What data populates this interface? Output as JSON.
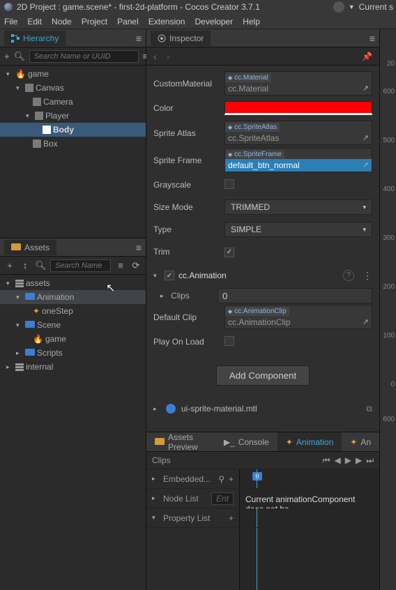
{
  "titlebar": "2D Project : game.scene* - first-2d-platform - Cocos Creator 3.7.1",
  "toolbar": {
    "current": "Current s"
  },
  "menu": [
    "File",
    "Edit",
    "Node",
    "Project",
    "Panel",
    "Extension",
    "Developer",
    "Help"
  ],
  "hierarchy": {
    "title": "Hierarchy",
    "search_placeholder": "Search Name or UUID",
    "items": [
      {
        "label": "game",
        "depth": 0,
        "icon": "fire",
        "expanded": true
      },
      {
        "label": "Canvas",
        "depth": 1,
        "icon": "cube",
        "expanded": true
      },
      {
        "label": "Camera",
        "depth": 2,
        "icon": "cube"
      },
      {
        "label": "Player",
        "depth": 2,
        "icon": "cube",
        "expanded": true
      },
      {
        "label": "Body",
        "depth": 3,
        "icon": "cube",
        "selected": true
      },
      {
        "label": "Box",
        "depth": 2,
        "icon": "cube"
      }
    ]
  },
  "assets": {
    "title": "Assets",
    "search_placeholder": "Search Name",
    "items": [
      {
        "label": "assets",
        "depth": 0,
        "icon": "db",
        "expanded": true
      },
      {
        "label": "Animation",
        "depth": 1,
        "icon": "folder-blue",
        "expanded": true,
        "selected": true
      },
      {
        "label": "oneStep",
        "depth": 2,
        "icon": "anim"
      },
      {
        "label": "Scene",
        "depth": 1,
        "icon": "folder-blue",
        "expanded": true
      },
      {
        "label": "game",
        "depth": 2,
        "icon": "fire"
      },
      {
        "label": "Scripts",
        "depth": 1,
        "icon": "folder-blue"
      },
      {
        "label": "internal",
        "depth": 0,
        "icon": "db"
      }
    ]
  },
  "inspector": {
    "title": "Inspector",
    "custom_material": {
      "label": "CustomMaterial",
      "tag": "cc.Material",
      "value": "cc.Material"
    },
    "color": {
      "label": "Color",
      "value": "#ff0000"
    },
    "sprite_atlas": {
      "label": "Sprite Atlas",
      "tag": "cc.SpriteAtlas",
      "value": "cc.SpriteAtlas"
    },
    "sprite_frame": {
      "label": "Sprite Frame",
      "tag": "cc.SpriteFrame",
      "value": "default_btn_normal"
    },
    "grayscale": {
      "label": "Grayscale",
      "checked": false
    },
    "size_mode": {
      "label": "Size Mode",
      "value": "TRIMMED"
    },
    "type": {
      "label": "Type",
      "value": "SIMPLE"
    },
    "trim": {
      "label": "Trim",
      "checked": true
    },
    "animation": {
      "name": "cc.Animation",
      "enabled": true,
      "clips": {
        "label": "Clips",
        "count": "0"
      },
      "default_clip": {
        "label": "Default Clip",
        "tag": "cc.AnimationClip",
        "value": "cc.AnimationClip"
      },
      "play_on_load": {
        "label": "Play On Load",
        "checked": false
      }
    },
    "add_component": "Add Component",
    "material_ref": "ui-sprite-material.mtl"
  },
  "bottom": {
    "tabs": [
      {
        "label": "Assets Preview",
        "icon": "folder"
      },
      {
        "label": "Console",
        "icon": "console"
      },
      {
        "label": "Animation",
        "icon": "anim",
        "active": true
      },
      {
        "label": "An",
        "icon": "anim"
      }
    ],
    "clips_label": "Clips",
    "embedded": "Embedded...",
    "node_list": "Node List",
    "enter_placeholder": "Ent",
    "property_list": "Property List",
    "message": "Current animationComponent does not ha",
    "key0": "0"
  },
  "ruler": [
    "20",
    "600",
    "500",
    "400",
    "300",
    "200",
    "100",
    "0",
    "600"
  ]
}
